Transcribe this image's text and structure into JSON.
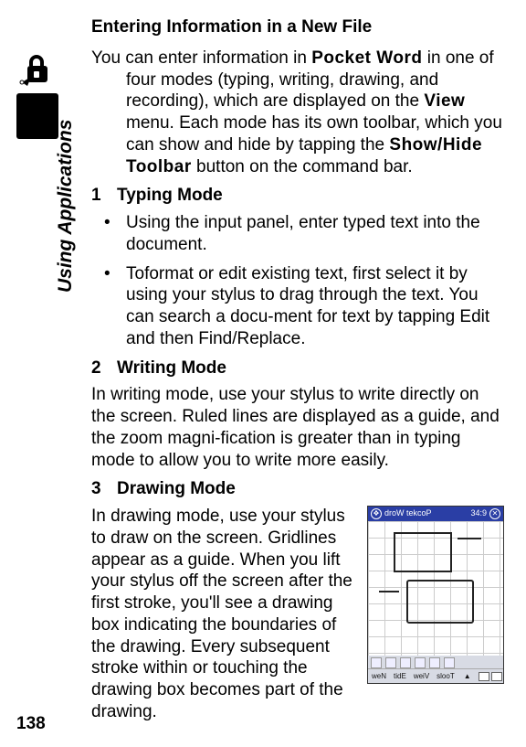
{
  "page_number": "138",
  "side_label": "Using Applications",
  "heading": "Entering Information in a New File",
  "intro": {
    "pre1": "You can enter information in ",
    "kw1": "Pocket Word",
    "mid1": " in one of four modes (typing, writing, drawing, and recording), which are displayed on the ",
    "kw2": "View",
    "mid2": " menu. Each mode has its own toolbar, which you can show and hide by tapping the ",
    "kw3": "Show/Hide Toolbar",
    "post": " button on the command bar."
  },
  "sections": [
    {
      "num": "1",
      "title": "Typing Mode",
      "bullets": [
        "Using the input panel, enter typed text into the document.",
        "Toformat or edit existing text, first select it by using your stylus to drag through the text. You can search a docu-ment for text by tapping Edit and then Find/Replace."
      ]
    },
    {
      "num": "2",
      "title": "Writing Mode",
      "body": "In writing mode, use your stylus to write directly on the screen. Ruled lines are displayed as a guide, and the zoom magni-fication is greater than in typing mode to allow you to write more easily."
    },
    {
      "num": "3",
      "title": "Drawing Mode",
      "body": "In drawing mode, use your stylus to draw on the screen. Gridlines appear as a guide. When you lift your stylus off the screen after the first stroke, you'll see a drawing box indicating the boundaries of the drawing. Every subsequent stroke within or touching the drawing box becomes part of the drawing."
    }
  ],
  "screenshot": {
    "title_app": "Pocket Word",
    "title_time": "9:43",
    "menu": [
      "New",
      "Edit",
      "View",
      "Tools"
    ]
  }
}
